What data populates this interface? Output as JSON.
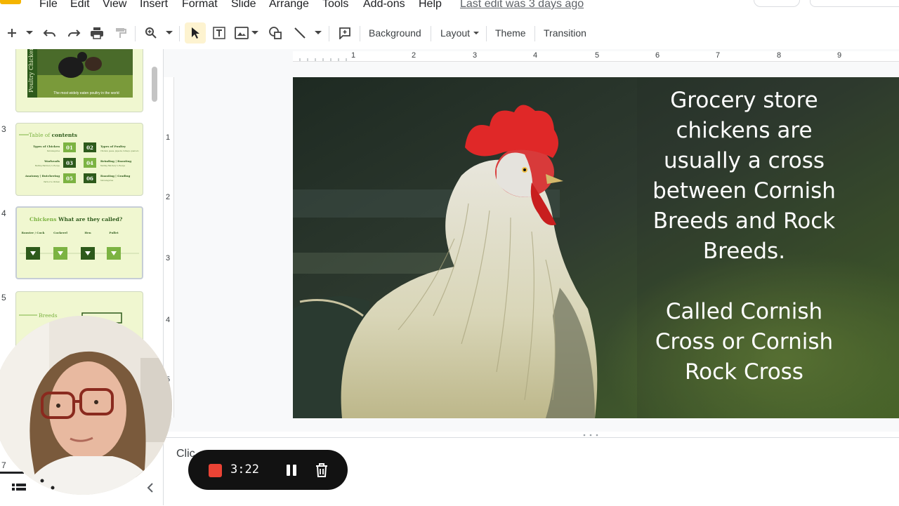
{
  "menu": {
    "items": [
      "File",
      "Edit",
      "View",
      "Insert",
      "Format",
      "Slide",
      "Arrange",
      "Tools",
      "Add-ons",
      "Help"
    ],
    "last_edit": "Last edit was 3 days ago"
  },
  "toolbar": {
    "background_label": "Background",
    "layout_label": "Layout",
    "theme_label": "Theme",
    "transition_label": "Transition",
    "icons": [
      "add-icon",
      "undo-icon",
      "redo-icon",
      "print-icon",
      "paint-format-icon",
      "zoom-icon",
      "select-icon",
      "text-box-icon",
      "image-icon",
      "shape-icon",
      "line-icon",
      "comment-icon"
    ]
  },
  "filmstrip": {
    "slides": [
      {
        "number": "",
        "title": "Poultry Chicken",
        "caption": "The most widely eaten poultry in the world"
      },
      {
        "number": "3",
        "title_plain": "Table of ",
        "title_bold": "contents",
        "items": [
          {
            "num": "01",
            "label": "Types of Chicken",
            "sub": "Subcategories"
          },
          {
            "num": "02",
            "label": "Types of Poultry",
            "sub": "Chicken, geese, pigeons, turkeys, quail etc."
          },
          {
            "num": "03",
            "label": "Warheads",
            "sub": "Melting Hatchery to Recipe"
          },
          {
            "num": "04",
            "label": "Brinding | Roasting",
            "sub": "Melting Hatchery to Recipe"
          },
          {
            "num": "05",
            "label": "Anatomy | Butchering",
            "sub": "Parts of a chicken"
          },
          {
            "num": "06",
            "label": "Roasting | Grading",
            "sub": "Subcategories"
          }
        ]
      },
      {
        "number": "4",
        "title_accent": "Chickens",
        "title_rest": " What are they called?",
        "items": [
          "Rooster / Cock",
          "Cockerel",
          "Hen",
          "Pullet"
        ]
      },
      {
        "number": "5",
        "title": "Breeds"
      },
      {
        "number": "7"
      }
    ]
  },
  "ruler": {
    "h_numbers": [
      "1",
      "2",
      "3",
      "4",
      "5",
      "6",
      "7",
      "8",
      "9"
    ],
    "v_numbers": [
      "1",
      "2",
      "3",
      "4",
      "5"
    ]
  },
  "slide": {
    "text_lines_1": [
      "Grocery store",
      "chickens are",
      "usually a cross",
      "between Cornish",
      "Breeds and Rock",
      "Breeds."
    ],
    "text_lines_2": [
      "Called Cornish",
      "Cross or Cornish",
      "Rock Cross"
    ]
  },
  "notes": {
    "placeholder_visible": "Clic"
  },
  "recorder": {
    "time": "3:22",
    "stop_color": "#ea4335"
  },
  "colors": {
    "thumb_bg": "#f0f7d0",
    "thumb_green": "#2d5a1b",
    "accent_green": "#7cb342"
  }
}
